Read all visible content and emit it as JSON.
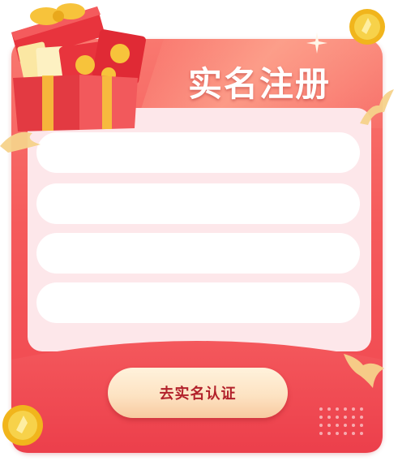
{
  "title": "实名注册",
  "form": {
    "fields": [
      {
        "value": "",
        "placeholder": ""
      },
      {
        "value": "",
        "placeholder": ""
      },
      {
        "value": "",
        "placeholder": ""
      },
      {
        "value": "",
        "placeholder": ""
      }
    ]
  },
  "cta": {
    "label": "去实名认证"
  },
  "icons": {
    "gift_box": "gift-box-icon",
    "coin_top_right": "gold-coin-icon",
    "coin_bottom_left": "gold-coin-icon",
    "sparkle": "sparkle-icon",
    "ribbons": "ribbon-icon",
    "dot_grid": "dot-grid-icon"
  },
  "colors": {
    "card_top": "#f9786f",
    "card_bottom": "#f0454f",
    "panel": "#fde7ea",
    "button_text": "#b2212b",
    "button_top": "#fff2dc",
    "button_bottom": "#f8caa0",
    "coin": "#f4c430"
  }
}
